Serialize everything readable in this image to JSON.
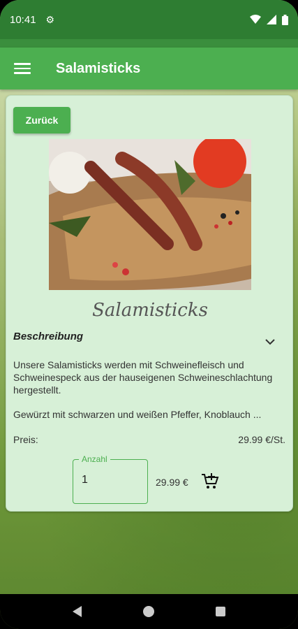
{
  "status_bar": {
    "time": "10:41",
    "icons": [
      "gear-icon",
      "wifi-icon",
      "signal-icon",
      "battery-icon"
    ]
  },
  "app_bar": {
    "title": "Salamisticks",
    "menu_icon": "hamburger-menu-icon"
  },
  "product": {
    "back_label": "Zurück",
    "name": "Salamisticks",
    "description_title": "Beschreibung",
    "description_p1": "Unsere Salamisticks werden mit Schweinefleisch und Schweinespeck aus der hauseigenen Schweineschlachtung hergestellt.",
    "description_p2": "Gewürzt mit schwarzen und weißen Pfeffer, Knoblauch ...",
    "price_label": "Preis:",
    "price_value": "29.99 €/St.",
    "quantity_label": "Anzahl",
    "quantity_value": "1",
    "total": "29.99 €",
    "cart_icon": "add-to-cart-icon"
  },
  "colors": {
    "primary": "#4caf50",
    "status_bar": "#2e7d32",
    "card_bg": "#d7f0d7"
  }
}
